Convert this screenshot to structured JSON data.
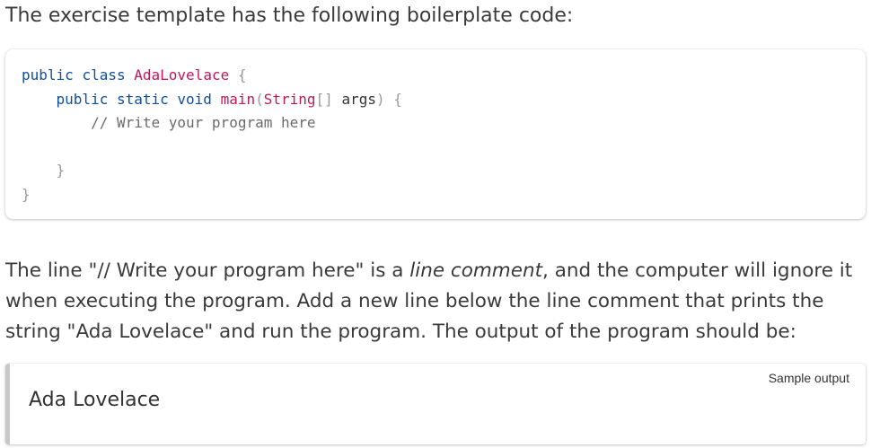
{
  "intro_text": "The exercise template has the following boilerplate code:",
  "code": {
    "line1": {
      "kw1": "public",
      "kw2": "class",
      "name": "AdaLovelace",
      "brace": "{"
    },
    "line2": {
      "kw1": "public",
      "kw2": "static",
      "kw3": "void",
      "fn": "main",
      "paren_open": "(",
      "type": "String",
      "brackets": "[]",
      "arg": "args",
      "paren_close": ")",
      "brace": "{"
    },
    "line3": {
      "comment": "// Write your program here"
    },
    "line5": {
      "brace": "}"
    },
    "line6": {
      "brace": "}"
    }
  },
  "paragraph": {
    "part1": "The line \"// Write your program here\" is a ",
    "emphasis": "line comment",
    "part2": ", and the computer will ignore it when executing the program. Add a new line below the line comment that prints the string \"Ada Lovelace\" and run the program. The output of the program should be:"
  },
  "sample_output": {
    "label": "Sample output",
    "text": "Ada Lovelace"
  },
  "colors": {
    "keyword": "#0e4f9e",
    "identifier_accent": "#c2185b",
    "comment": "#6b6b6b",
    "brace": "#9a9a9a"
  }
}
